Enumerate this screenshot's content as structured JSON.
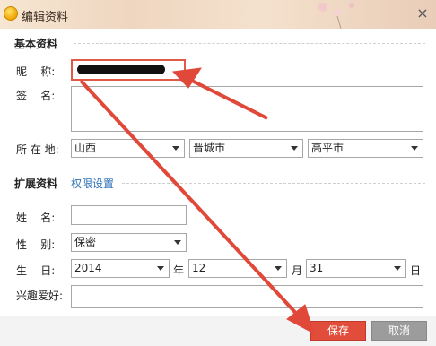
{
  "window": {
    "title": "编辑资料",
    "close_glyph": "×"
  },
  "basic": {
    "heading": "基本资料",
    "nickname_label": "昵    称:",
    "signature_label": "签    名:",
    "location_label": "所 在 地:",
    "location": {
      "province": "山西",
      "city": "晋城市",
      "district": "高平市"
    }
  },
  "extended": {
    "heading": "扩展资料",
    "privacy_link": "权限设置",
    "surname_label": "姓    名:",
    "gender_label": "性    别:",
    "gender_value": "保密",
    "birthday_label": "生    日:",
    "year": "2014",
    "year_unit": "年",
    "month": "12",
    "month_unit": "月",
    "day": "31",
    "day_unit": "日",
    "hobby_label": "兴趣爱好:"
  },
  "footer": {
    "save_label": "保存",
    "cancel_label": "取消"
  },
  "colors": {
    "annotation_red": "#e0483a",
    "save_button": "#e24c3a"
  }
}
